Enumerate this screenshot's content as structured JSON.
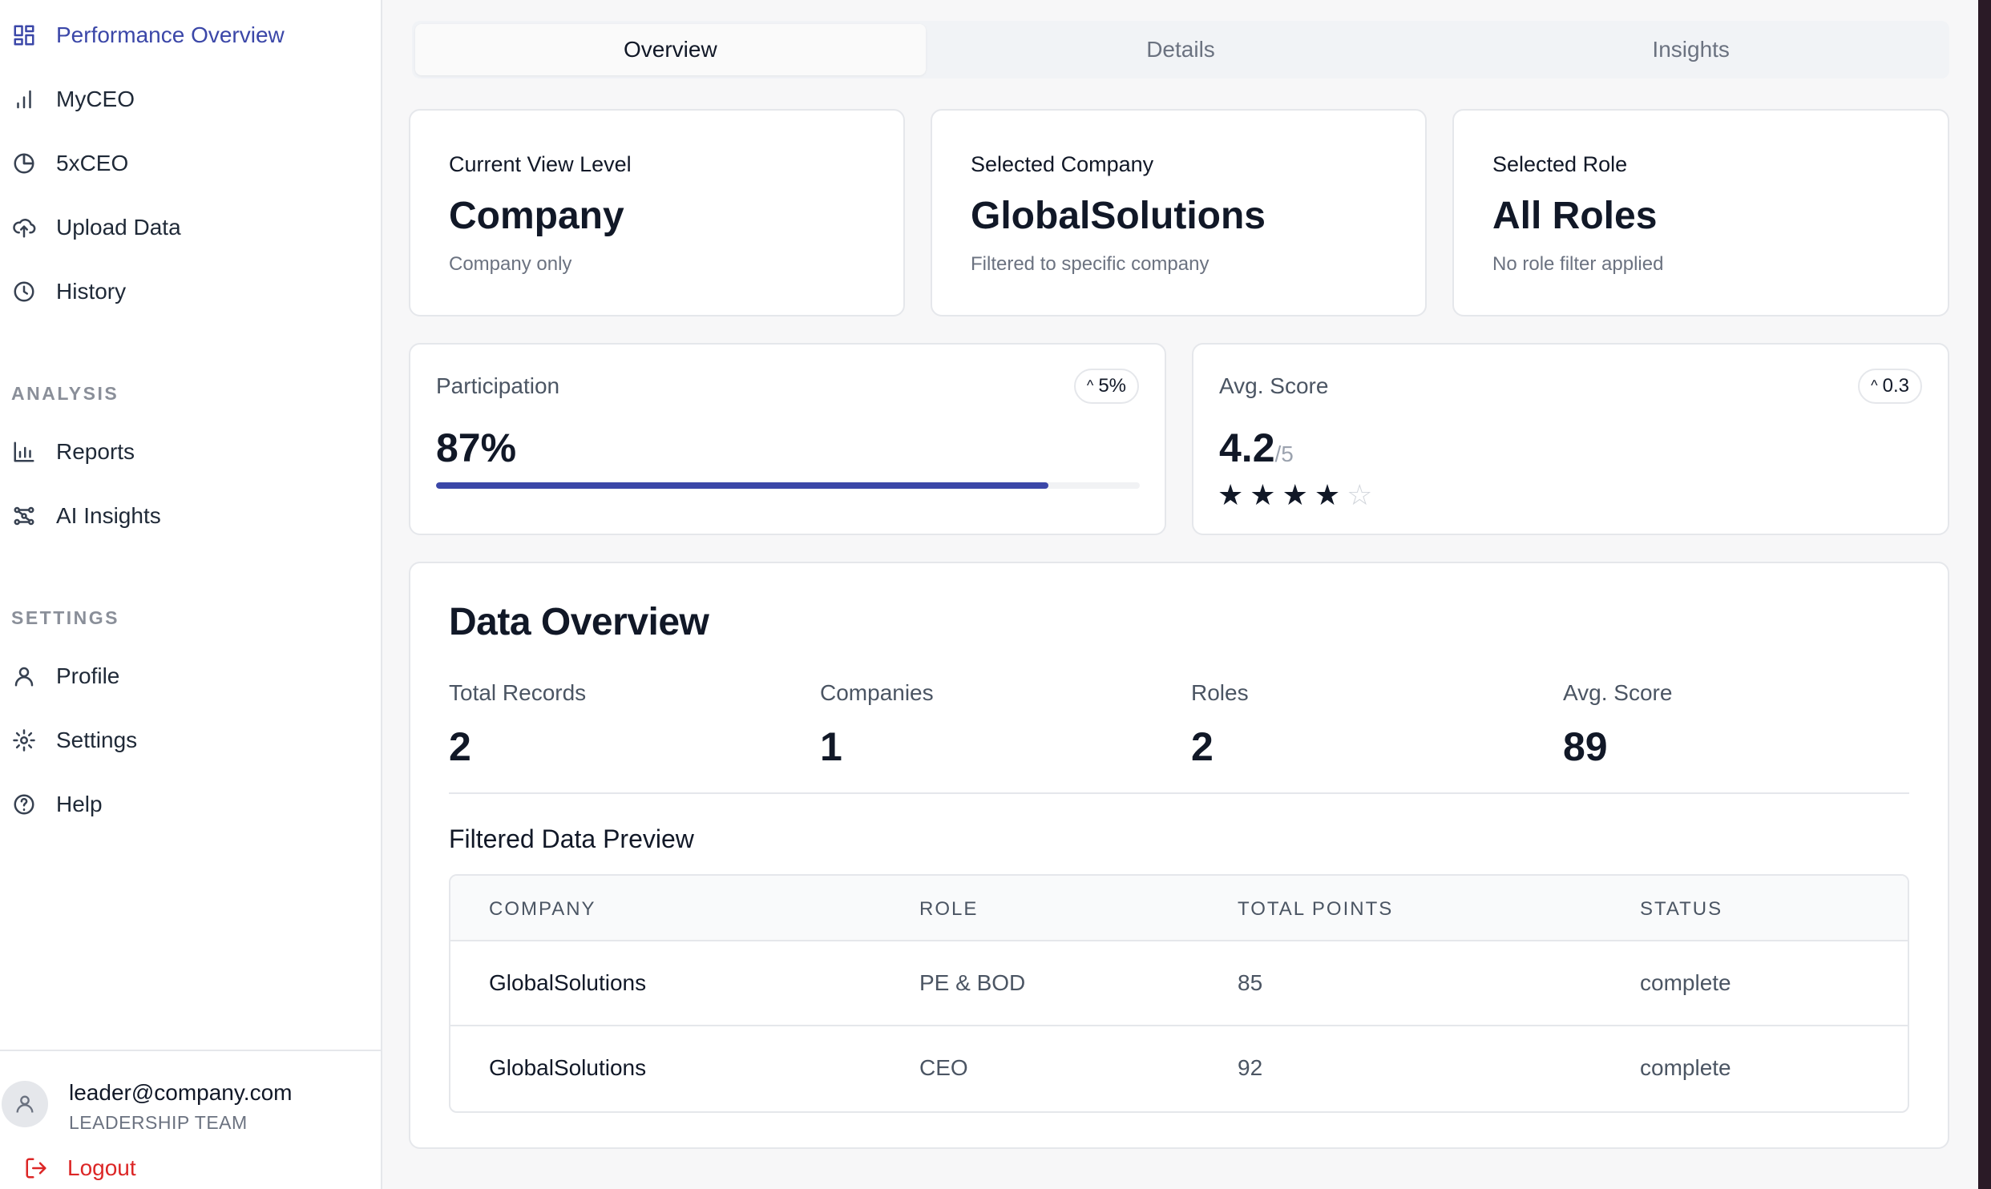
{
  "sidebar": {
    "nav": [
      {
        "label": "Performance Overview",
        "icon": "grid-icon",
        "active": true
      },
      {
        "label": "MyCEO",
        "icon": "bar-chart-icon"
      },
      {
        "label": "5xCEO",
        "icon": "pie-chart-icon"
      },
      {
        "label": "Upload Data",
        "icon": "cloud-upload-icon"
      },
      {
        "label": "History",
        "icon": "clock-icon"
      }
    ],
    "analysis_label": "ANALYSIS",
    "analysis": [
      {
        "label": "Reports",
        "icon": "chart-icon"
      },
      {
        "label": "AI Insights",
        "icon": "workflow-icon"
      }
    ],
    "settings_label": "SETTINGS",
    "settings": [
      {
        "label": "Profile",
        "icon": "user-icon"
      },
      {
        "label": "Settings",
        "icon": "gear-icon"
      },
      {
        "label": "Help",
        "icon": "help-circle-icon"
      }
    ],
    "user": {
      "email": "leader@company.com",
      "team": "LEADERSHIP TEAM"
    },
    "logout_label": "Logout"
  },
  "tabs": [
    {
      "label": "Overview",
      "active": true
    },
    {
      "label": "Details"
    },
    {
      "label": "Insights"
    }
  ],
  "info_cards": [
    {
      "label": "Current View Level",
      "value": "Company",
      "sub": "Company only"
    },
    {
      "label": "Selected Company",
      "value": "GlobalSolutions",
      "sub": "Filtered to specific company"
    },
    {
      "label": "Selected Role",
      "value": "All Roles",
      "sub": "No role filter applied"
    }
  ],
  "participation": {
    "label": "Participation",
    "value": "87%",
    "change": "5%",
    "progress_percent": 87
  },
  "avg_score": {
    "label": "Avg. Score",
    "value": "4.2",
    "denominator": "/5",
    "change": "0.3",
    "stars_filled": 4,
    "stars_total": 5
  },
  "data_overview": {
    "title": "Data Overview",
    "stats": [
      {
        "label": "Total Records",
        "value": "2"
      },
      {
        "label": "Companies",
        "value": "1"
      },
      {
        "label": "Roles",
        "value": "2"
      },
      {
        "label": "Avg. Score",
        "value": "89"
      }
    ],
    "preview_title": "Filtered Data Preview",
    "columns": [
      "COMPANY",
      "ROLE",
      "TOTAL POINTS",
      "STATUS"
    ],
    "rows": [
      {
        "company": "GlobalSolutions",
        "role": "PE & BOD",
        "points": "85",
        "status": "complete"
      },
      {
        "company": "GlobalSolutions",
        "role": "CEO",
        "points": "92",
        "status": "complete"
      }
    ]
  },
  "colors": {
    "accent": "#3b47a8",
    "danger": "#dc2626"
  }
}
